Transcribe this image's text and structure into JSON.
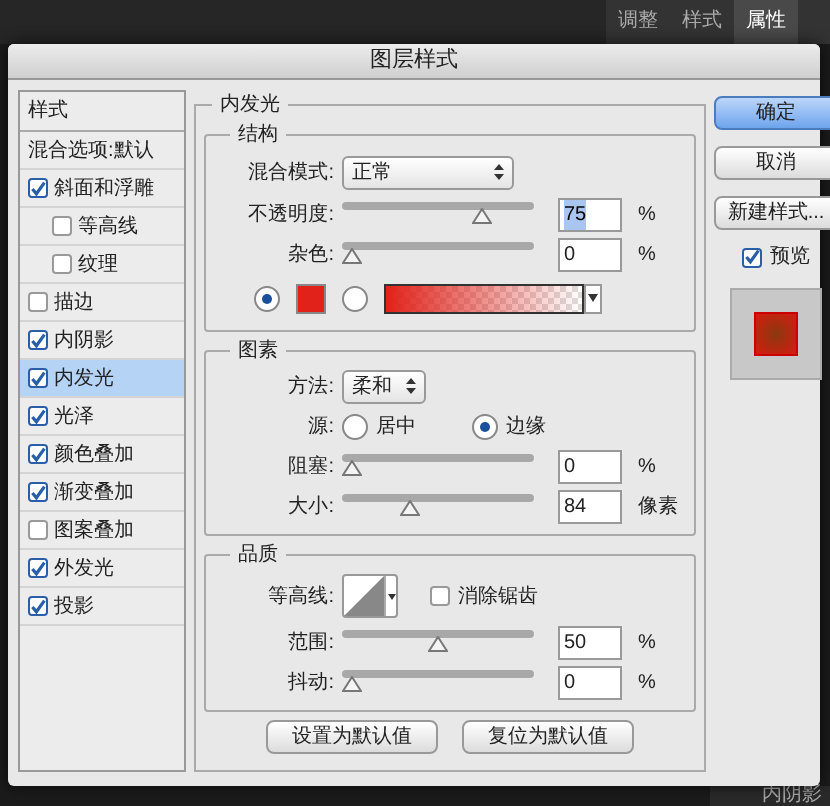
{
  "background_panel": {
    "tabs": [
      {
        "label": "调整",
        "selected": false
      },
      {
        "label": "样式",
        "selected": false
      },
      {
        "label": "属性",
        "selected": true
      }
    ],
    "layer_item": "内阴影"
  },
  "dialog": {
    "title": "图层样式"
  },
  "styles_list": {
    "header": "样式",
    "items": [
      {
        "label": "混合选项:默认",
        "kind": "plain",
        "selected": false
      },
      {
        "label": "斜面和浮雕",
        "kind": "checkbox",
        "checked": true,
        "selected": false,
        "children": [
          {
            "label": "等高线",
            "kind": "checkbox",
            "checked": false,
            "selected": false
          },
          {
            "label": "纹理",
            "kind": "checkbox",
            "checked": false,
            "selected": false
          }
        ]
      },
      {
        "label": "描边",
        "kind": "checkbox",
        "checked": false,
        "selected": false
      },
      {
        "label": "内阴影",
        "kind": "checkbox",
        "checked": true,
        "selected": false
      },
      {
        "label": "内发光",
        "kind": "checkbox",
        "checked": true,
        "selected": true
      },
      {
        "label": "光泽",
        "kind": "checkbox",
        "checked": true,
        "selected": false
      },
      {
        "label": "颜色叠加",
        "kind": "checkbox",
        "checked": true,
        "selected": false
      },
      {
        "label": "渐变叠加",
        "kind": "checkbox",
        "checked": true,
        "selected": false
      },
      {
        "label": "图案叠加",
        "kind": "checkbox",
        "checked": false,
        "selected": false
      },
      {
        "label": "外发光",
        "kind": "checkbox",
        "checked": true,
        "selected": false
      },
      {
        "label": "投影",
        "kind": "checkbox",
        "checked": true,
        "selected": false
      }
    ]
  },
  "panel": {
    "title": "内发光",
    "structure": {
      "title": "结构",
      "blend_mode": {
        "label": "混合模式:",
        "value": "正常"
      },
      "opacity": {
        "label": "不透明度:",
        "level": 0.75,
        "value": "75",
        "unit": "%",
        "highlighted": true
      },
      "noise": {
        "label": "杂色:",
        "level": 0,
        "value": "0",
        "unit": "%",
        "highlighted": false
      },
      "fill_options": [
        {
          "kind": "color",
          "selected": true,
          "color": "#e0221a"
        },
        {
          "kind": "gradient",
          "selected": false
        }
      ]
    },
    "elements": {
      "title": "图素",
      "method": {
        "label": "方法:",
        "value": "柔和"
      },
      "source": {
        "label": "源:",
        "options": [
          {
            "label": "居中",
            "selected": false
          },
          {
            "label": "边缘",
            "selected": true
          }
        ]
      },
      "choke": {
        "label": "阻塞:",
        "level": 0,
        "value": "0",
        "unit": "%",
        "highlighted": false
      },
      "size": {
        "label": "大小:",
        "level": 0.34,
        "value": "84",
        "unit": "像素",
        "highlighted": false
      }
    },
    "quality": {
      "title": "品质",
      "contour": {
        "label": "等高线:"
      },
      "anti_alias": {
        "label": "消除锯齿",
        "checked": false
      },
      "range": {
        "label": "范围:",
        "level": 0.5,
        "value": "50",
        "unit": "%",
        "highlighted": false
      },
      "jitter": {
        "label": "抖动:",
        "level": 0,
        "value": "0",
        "unit": "%",
        "highlighted": false
      }
    },
    "buttons": [
      "设置为默认值",
      "复位为默认值"
    ]
  },
  "actions": [
    {
      "label": "确定",
      "kind": "primary"
    },
    {
      "label": "取消",
      "kind": "normal"
    },
    {
      "label": "新建样式...",
      "kind": "normal"
    }
  ],
  "preview": {
    "label": "预览",
    "checked": true
  }
}
